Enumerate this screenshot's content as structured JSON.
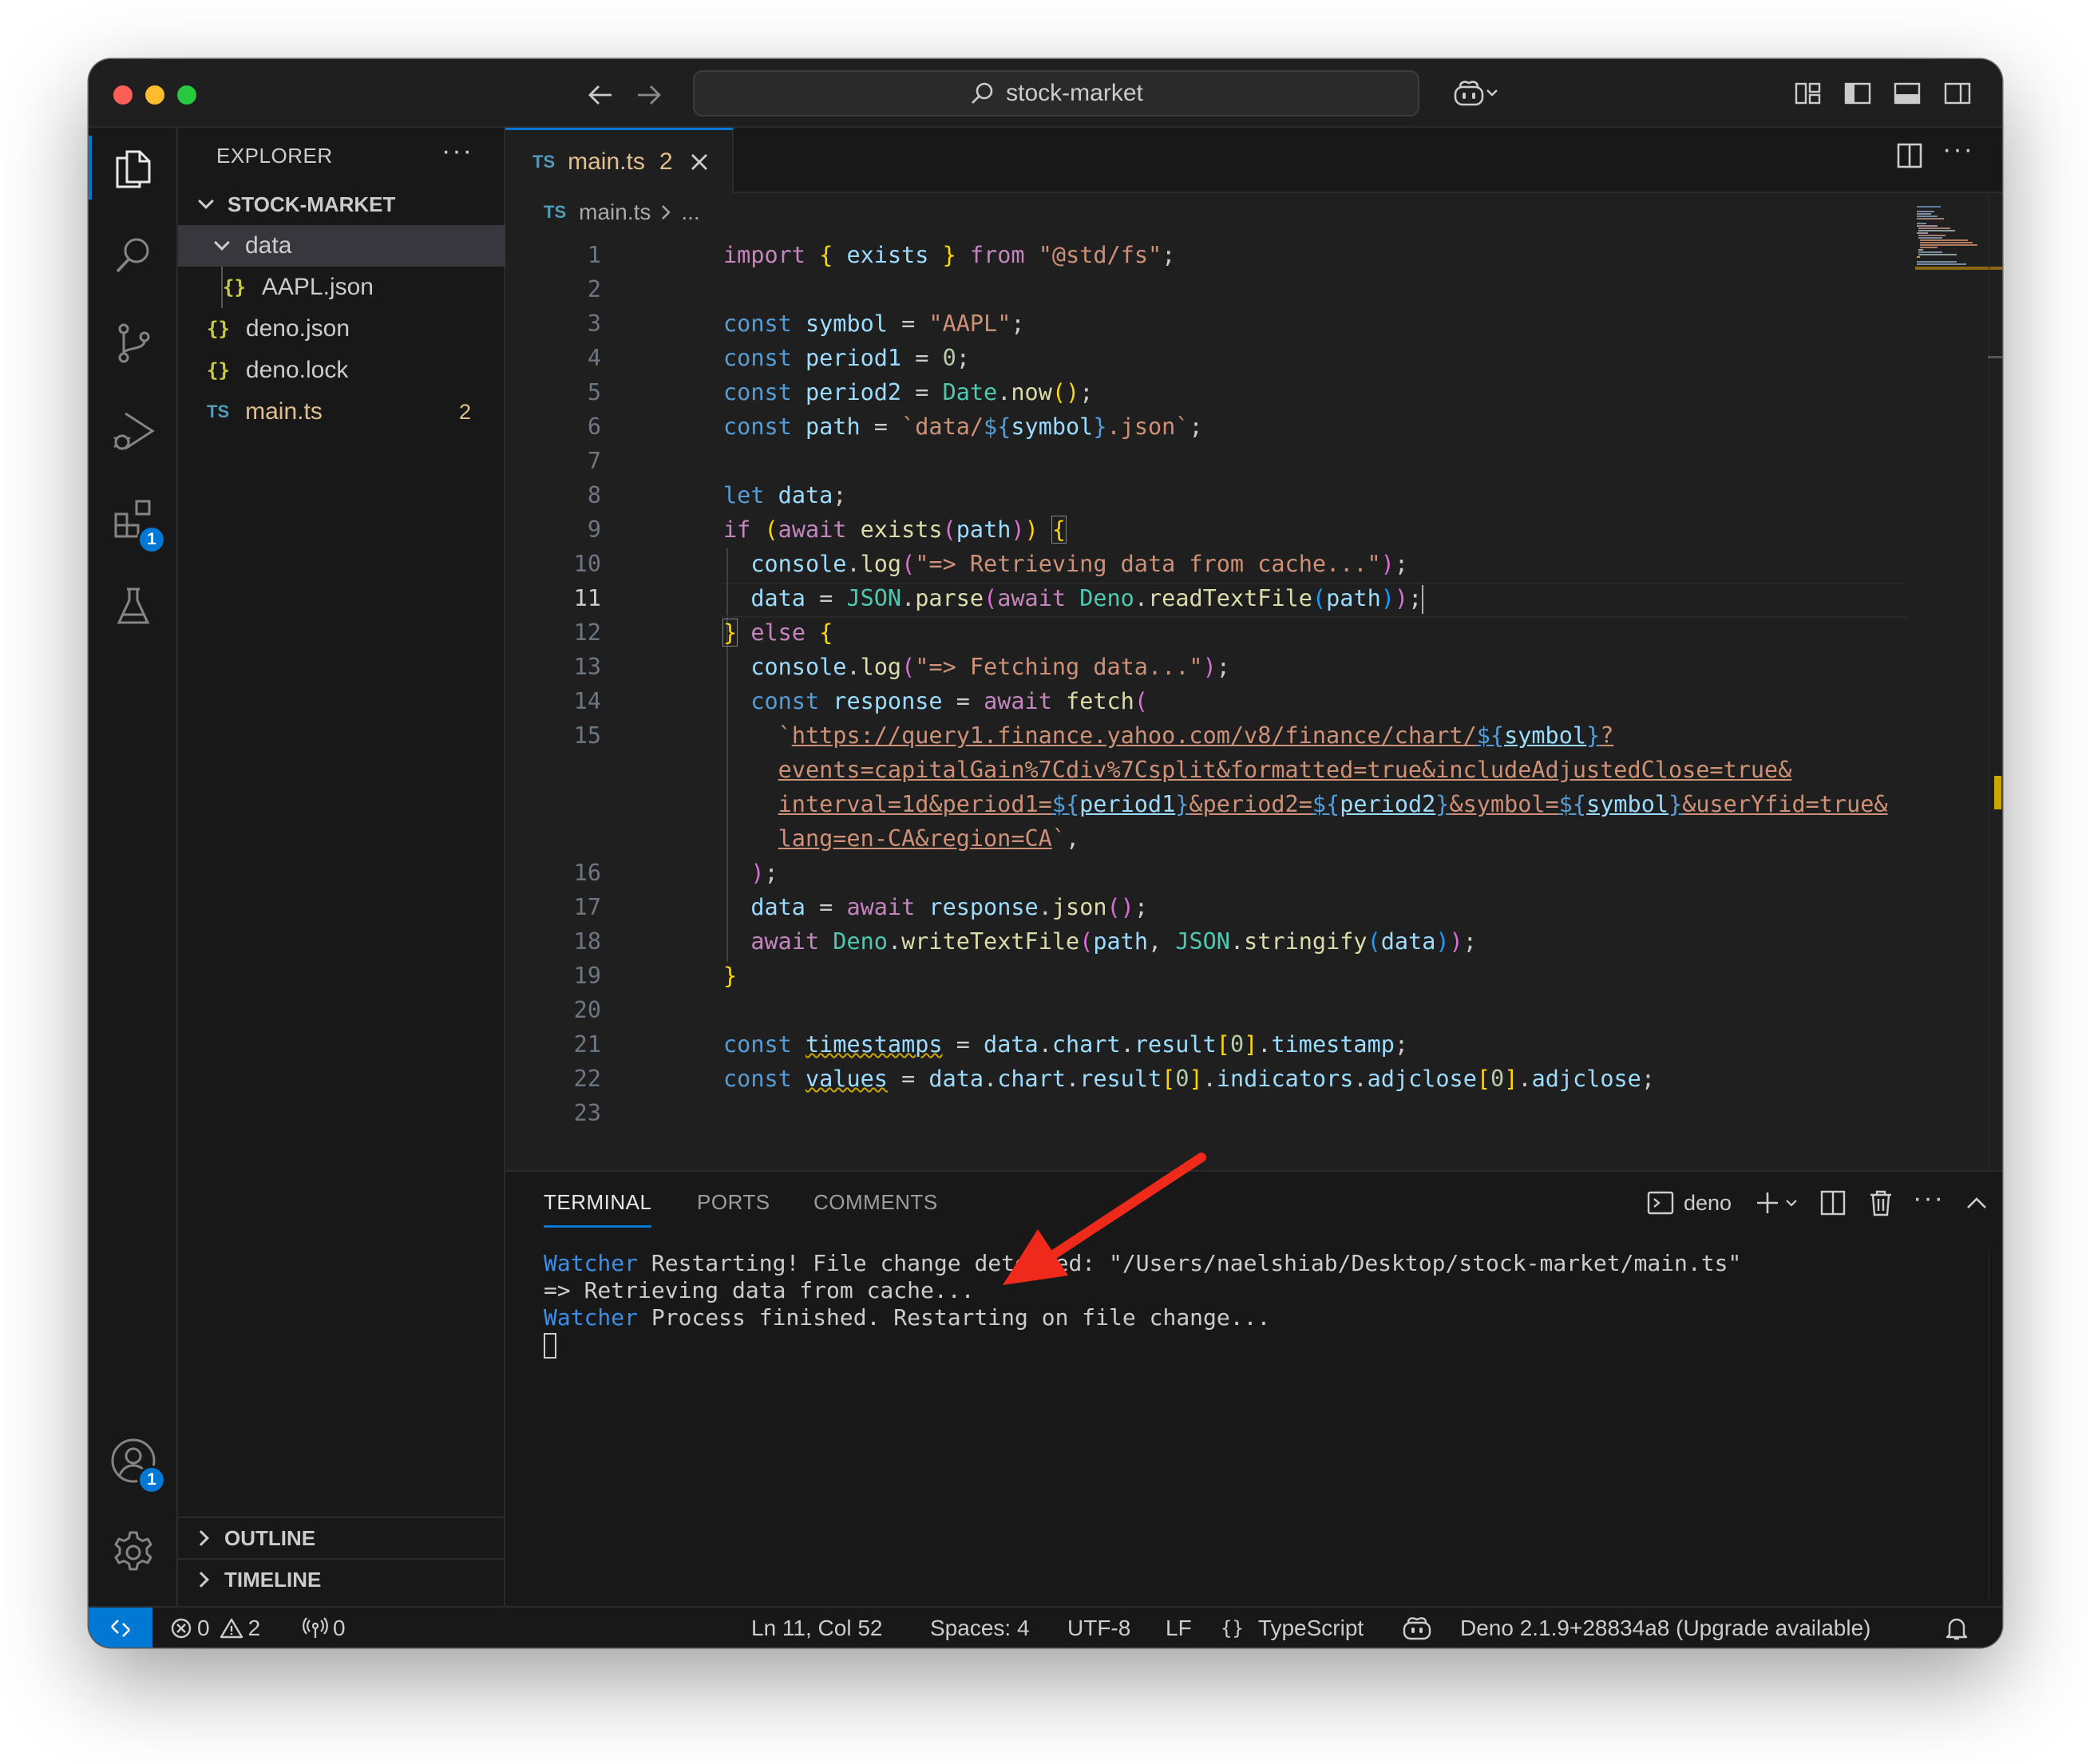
{
  "window": {
    "title": "stock-market"
  },
  "explorer": {
    "title": "EXPLORER",
    "more": "···",
    "root": "STOCK-MARKET",
    "items": [
      {
        "icon": "{}",
        "label": "AAPL.json"
      },
      {
        "icon": "{}",
        "label": "deno.json"
      },
      {
        "icon": "{}",
        "label": "deno.lock"
      },
      {
        "icon": "TS",
        "label": "main.ts",
        "badge": "2"
      }
    ],
    "folder": "data",
    "outline": "OUTLINE",
    "timeline": "TIMELINE"
  },
  "activity": {
    "extensions_badge": "1",
    "accounts_badge": "1"
  },
  "editor": {
    "tab": {
      "icon": "TS",
      "label": "main.ts",
      "count": "2"
    },
    "breadcrumb": {
      "icon": "TS",
      "file": "main.ts",
      "rest": "..."
    },
    "line_numbers": [
      "1",
      "2",
      "3",
      "4",
      "5",
      "6",
      "7",
      "8",
      "9",
      "10",
      "11",
      "12",
      "13",
      "14",
      "15",
      "16",
      "17",
      "18",
      "19",
      "20",
      "21",
      "22",
      "23"
    ],
    "current_line": "11"
  },
  "panel": {
    "tabs": [
      "TERMINAL",
      "PORTS",
      "COMMENTS"
    ],
    "shell": "deno",
    "terminal": [
      {
        "prefix": "Watcher",
        "text": " Restarting! File change detected: \"/Users/naelshiab/Desktop/stock-market/main.ts\""
      },
      {
        "prefix": "",
        "text": "=> Retrieving data from cache..."
      },
      {
        "prefix": "Watcher",
        "text": " Process finished. Restarting on file change..."
      }
    ]
  },
  "status": {
    "errors": "0",
    "warnings": "2",
    "ports": "0",
    "position": "Ln 11, Col 52",
    "spaces": "Spaces: 4",
    "encoding": "UTF-8",
    "eol": "LF",
    "language": "TypeScript",
    "deno": "Deno 2.1.9+28834a8 (Upgrade available)"
  },
  "colors": {
    "accent": "#0078d4",
    "annotation_arrow": "#f02a1a",
    "warning": "#cca700"
  }
}
